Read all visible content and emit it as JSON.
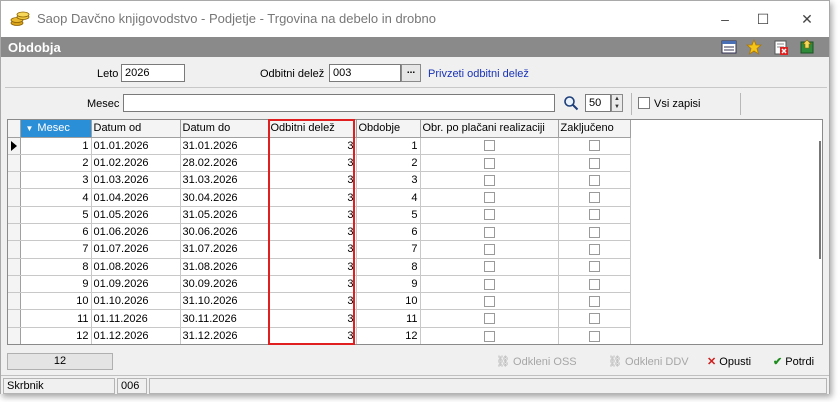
{
  "window": {
    "title": "Saop Davčno knjigovodstvo - Podjetje - Trgovina na debelo in drobno",
    "controls": {
      "minimize": "–",
      "maximize": "☐",
      "close": "✕"
    }
  },
  "header": {
    "title": "Obdobja",
    "icons": [
      "list-settings-icon",
      "favorite-star-icon",
      "delete-record-icon",
      "export-icon"
    ]
  },
  "filters": {
    "leto_label": "Leto",
    "leto_value": "2026",
    "odbitni_label": "Odbitni delež",
    "odbitni_value": "003",
    "odbitni_browse": "...",
    "privzeti_link": "Privzeti odbitni delež",
    "mesec_label": "Mesec",
    "mesec_value": "",
    "page_size": "50",
    "vsi_zapisi_label": "Vsi zapisi"
  },
  "table": {
    "columns": [
      "Mesec",
      "Datum od",
      "Datum do",
      "Odbitni delež",
      "Obdobje",
      "Obr. po plačani realizaciji",
      "Zaključeno"
    ],
    "sorted_column": "Mesec",
    "rows": [
      {
        "mesec": "1",
        "od": "01.01.2026",
        "do": "31.01.2026",
        "delez": "3",
        "obdobje": "1"
      },
      {
        "mesec": "2",
        "od": "01.02.2026",
        "do": "28.02.2026",
        "delez": "3",
        "obdobje": "2"
      },
      {
        "mesec": "3",
        "od": "01.03.2026",
        "do": "31.03.2026",
        "delez": "3",
        "obdobje": "3"
      },
      {
        "mesec": "4",
        "od": "01.04.2026",
        "do": "30.04.2026",
        "delez": "3",
        "obdobje": "4"
      },
      {
        "mesec": "5",
        "od": "01.05.2026",
        "do": "31.05.2026",
        "delez": "3",
        "obdobje": "5"
      },
      {
        "mesec": "6",
        "od": "01.06.2026",
        "do": "30.06.2026",
        "delez": "3",
        "obdobje": "6"
      },
      {
        "mesec": "7",
        "od": "01.07.2026",
        "do": "31.07.2026",
        "delez": "3",
        "obdobje": "7"
      },
      {
        "mesec": "8",
        "od": "01.08.2026",
        "do": "31.08.2026",
        "delez": "3",
        "obdobje": "8"
      },
      {
        "mesec": "9",
        "od": "01.09.2026",
        "do": "30.09.2026",
        "delez": "3",
        "obdobje": "9"
      },
      {
        "mesec": "10",
        "od": "01.10.2026",
        "do": "31.10.2026",
        "delez": "3",
        "obdobje": "10"
      },
      {
        "mesec": "11",
        "od": "01.11.2026",
        "do": "30.11.2026",
        "delez": "3",
        "obdobje": "11"
      },
      {
        "mesec": "12",
        "od": "01.12.2026",
        "do": "31.12.2026",
        "delez": "3",
        "obdobje": "12"
      }
    ]
  },
  "footer": {
    "record_count": "12",
    "buttons": {
      "odkleni_oss": "Odkleni OSS",
      "odkleni_ddv": "Odkleni DDV",
      "opusti": "Opusti",
      "potrdi": "Potrdi"
    }
  },
  "statusbar": {
    "user": "Skrbnik",
    "code": "006"
  },
  "colors": {
    "header_strip": "#8a8a8a",
    "sorted_header": "#2b8fd8",
    "highlight": "#e02020",
    "link": "#1a33b5"
  }
}
